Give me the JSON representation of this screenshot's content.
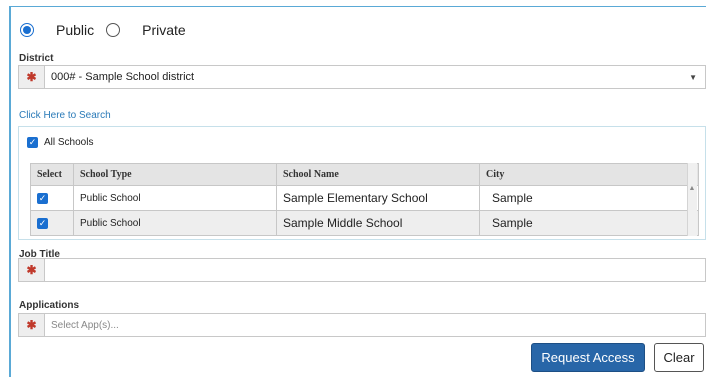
{
  "school_type_options": [
    {
      "label": "Public",
      "selected": true
    },
    {
      "label": "Private",
      "selected": false
    }
  ],
  "district": {
    "label": "District",
    "value": "000# - Sample School district"
  },
  "search_link": "Click Here to Search",
  "all_schools": {
    "label": "All Schools",
    "checked": true
  },
  "table": {
    "columns": [
      "Select",
      "School Type",
      "School Name",
      "City"
    ],
    "rows": [
      {
        "checked": true,
        "school_type": "Public School",
        "school_name": "Sample Elementary School",
        "city": "Sample"
      },
      {
        "checked": true,
        "school_type": "Public School",
        "school_name": "Sample Middle School",
        "city": "Sample"
      }
    ]
  },
  "job_title": {
    "label": "Job Title",
    "value": ""
  },
  "applications": {
    "label": "Applications",
    "placeholder": "Select App(s)..."
  },
  "buttons": {
    "request_access": "Request Access",
    "clear": "Clear"
  },
  "colors": {
    "accent": "#2866a8",
    "required": "#c0392b",
    "link": "#2a7ab8"
  }
}
